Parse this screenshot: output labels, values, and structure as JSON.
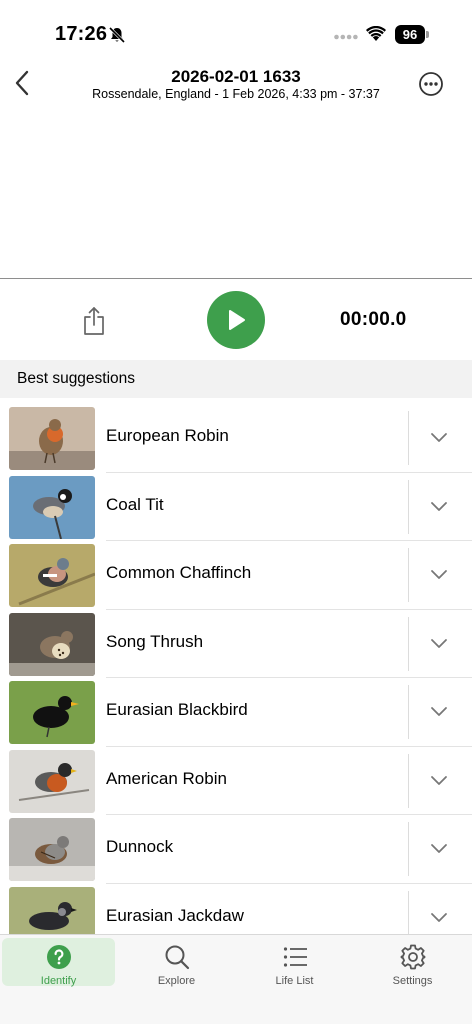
{
  "status_bar": {
    "time": "17:26",
    "battery": "96"
  },
  "header": {
    "title": "2026-02-01 1633",
    "subtitle": "Rossendale, England - 1 Feb 2026, 4:33 pm - 37:37"
  },
  "player": {
    "timer": "00:00.0"
  },
  "suggestions": {
    "title": "Best suggestions",
    "items": [
      {
        "name": "European Robin"
      },
      {
        "name": "Coal Tit"
      },
      {
        "name": "Common Chaffinch"
      },
      {
        "name": "Song Thrush"
      },
      {
        "name": "Eurasian Blackbird"
      },
      {
        "name": "American Robin"
      },
      {
        "name": "Dunnock"
      },
      {
        "name": "Eurasian Jackdaw"
      }
    ]
  },
  "tabbar": {
    "tabs": [
      {
        "label": "Identify",
        "icon": "question-circle-icon",
        "active": true
      },
      {
        "label": "Explore",
        "icon": "search-icon",
        "active": false
      },
      {
        "label": "Life List",
        "icon": "list-icon",
        "active": false
      },
      {
        "label": "Settings",
        "icon": "gear-icon",
        "active": false
      }
    ]
  },
  "colors": {
    "accent_green": "#3e9f4c",
    "active_tab_bg": "#dff0df"
  }
}
